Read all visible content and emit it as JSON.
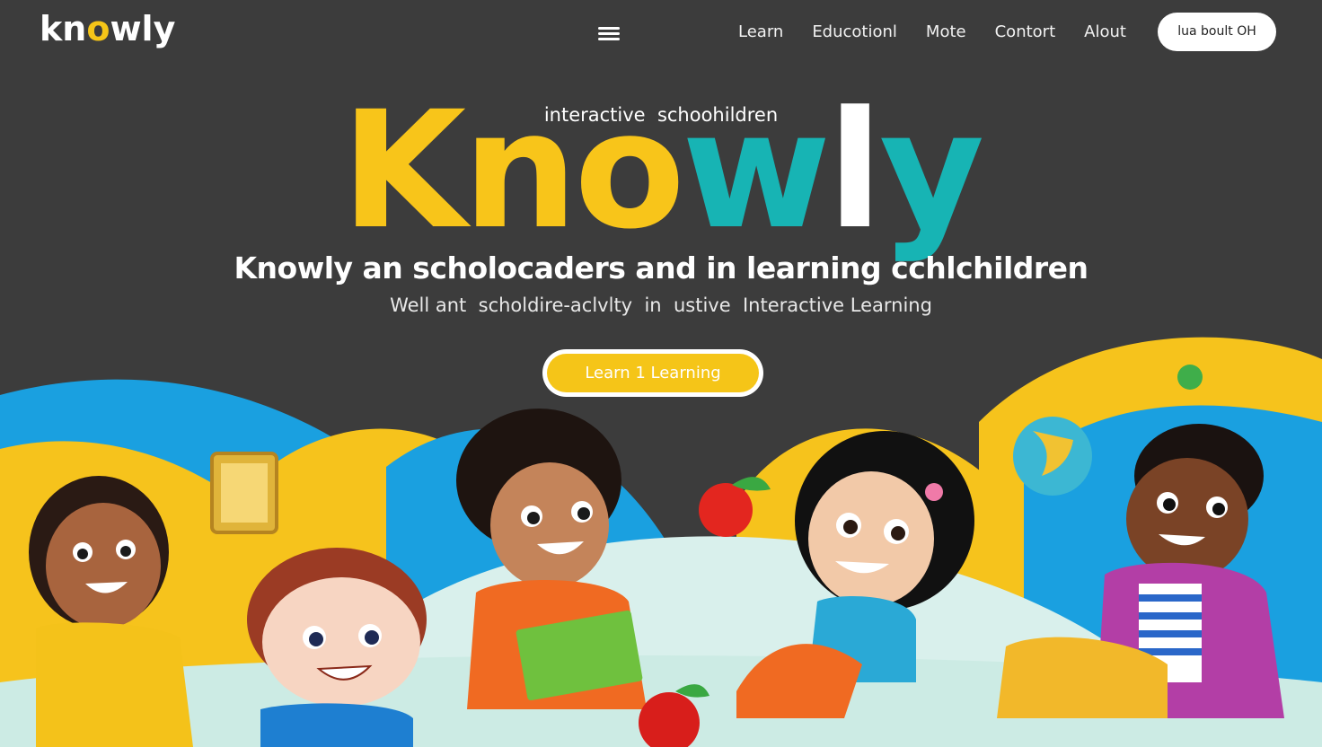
{
  "brand": {
    "logo_k": "kn",
    "logo_o": "o",
    "logo_rest": "wly"
  },
  "nav": {
    "items": [
      {
        "label": "Learn"
      },
      {
        "label": "Educotionl"
      },
      {
        "label": "Mote"
      },
      {
        "label": "Contort"
      },
      {
        "label": "Alout"
      }
    ],
    "cta_label": "lua boult OH"
  },
  "hero": {
    "kicker": "interactive  schoohildren",
    "title_parts": [
      "Kno",
      "w",
      "l",
      "y"
    ],
    "headline": "Knowly an scholocaders and in learning cchlchildren",
    "subline": "Well ant  scholdire-aclvlty  in  ustive  Interactive Learning",
    "button_label": "Learn 1 Learning"
  },
  "colors": {
    "background": "#3c3c3c",
    "accent_yellow": "#f5c518",
    "accent_teal": "#17b4b4",
    "accent_blue": "#1ea0e0"
  }
}
